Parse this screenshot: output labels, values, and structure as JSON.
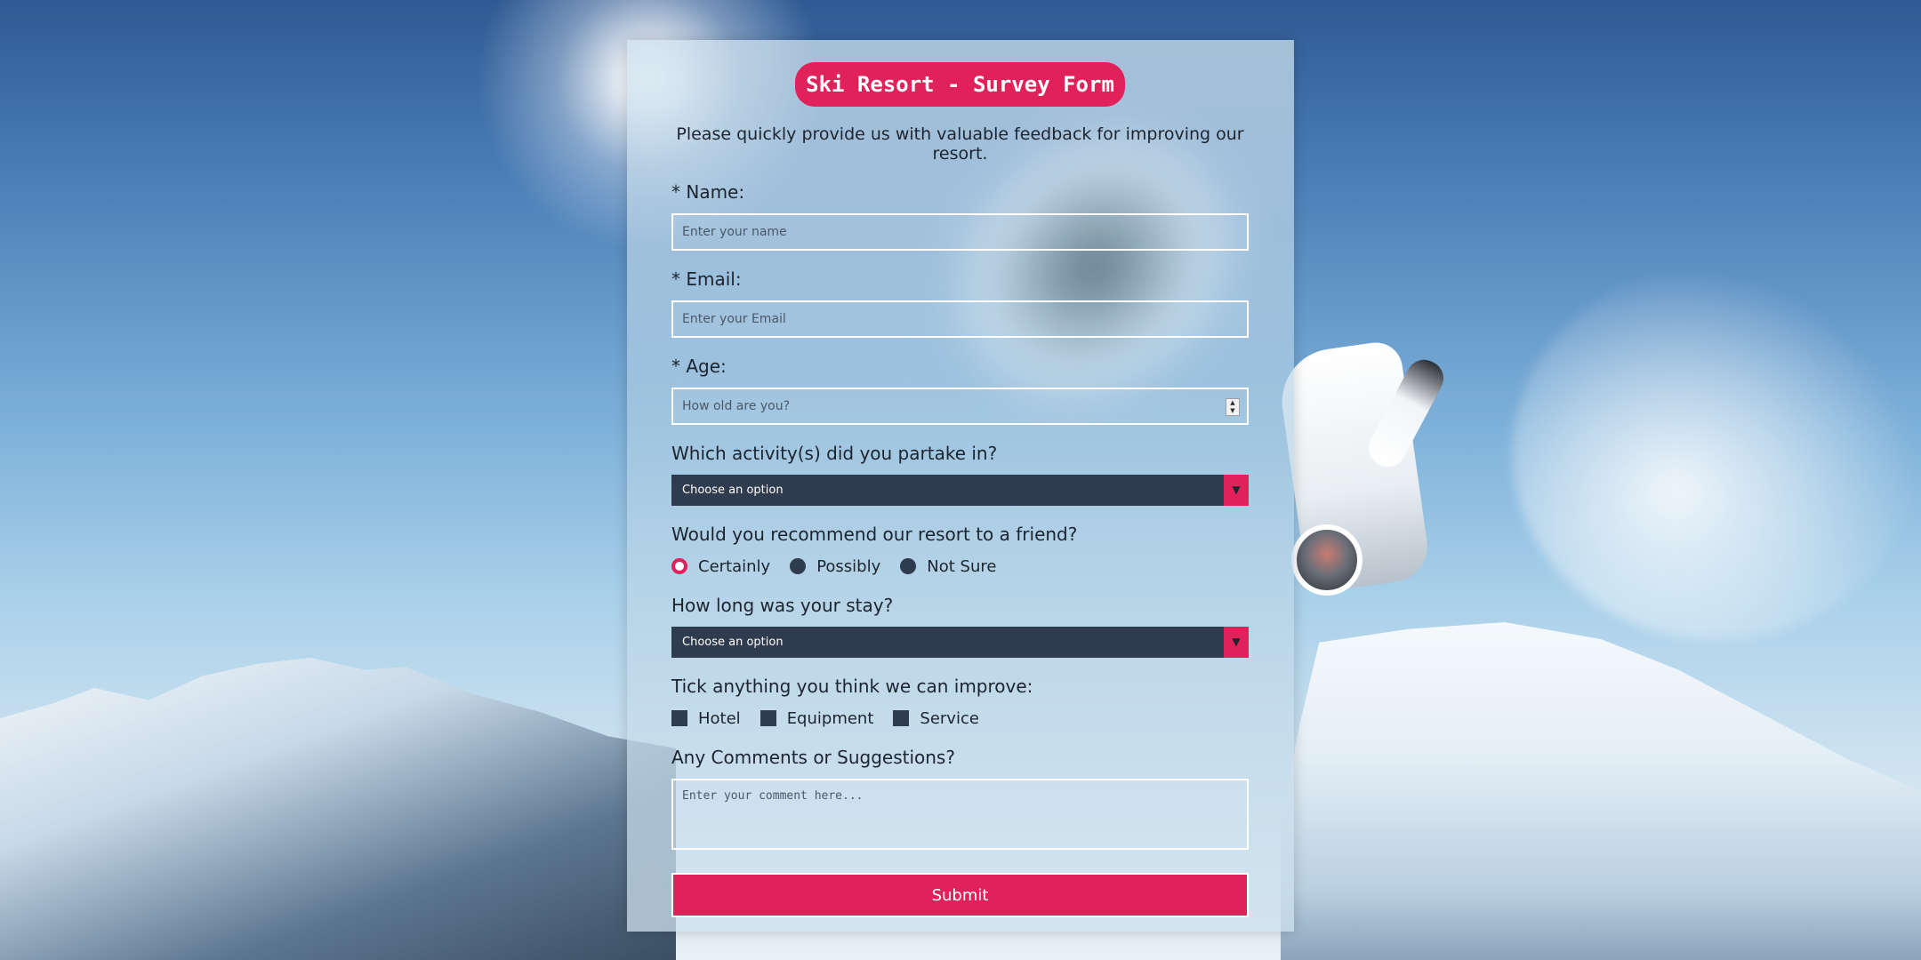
{
  "form": {
    "title": "Ski Resort - Survey Form",
    "subtitle": "Please quickly provide us with valuable feedback for improving our resort.",
    "name": {
      "label": "* Name:",
      "placeholder": "Enter your name"
    },
    "email": {
      "label": "* Email:",
      "placeholder": "Enter your Email"
    },
    "age": {
      "label": "* Age:",
      "placeholder": "How old are you?"
    },
    "activity": {
      "label": "Which activity(s) did you partake in?",
      "selected": "Choose an option"
    },
    "recommend": {
      "label": "Would you recommend our resort to a friend?",
      "options": [
        "Certainly",
        "Possibly",
        "Not Sure"
      ],
      "selected": "Certainly"
    },
    "stay": {
      "label": "How long was your stay?",
      "selected": "Choose an option"
    },
    "improve": {
      "label": "Tick anything you think we can improve:",
      "options": [
        "Hotel",
        "Equipment",
        "Service"
      ]
    },
    "comments": {
      "label": "Any Comments or Suggestions?",
      "placeholder": "Enter your comment here..."
    },
    "submit_label": "Submit"
  },
  "colors": {
    "accent": "#e0215a",
    "dark_control": "#2f3b4f"
  },
  "icons": {
    "dropdown": "triangle-down",
    "spinner": "up-down-arrows"
  }
}
